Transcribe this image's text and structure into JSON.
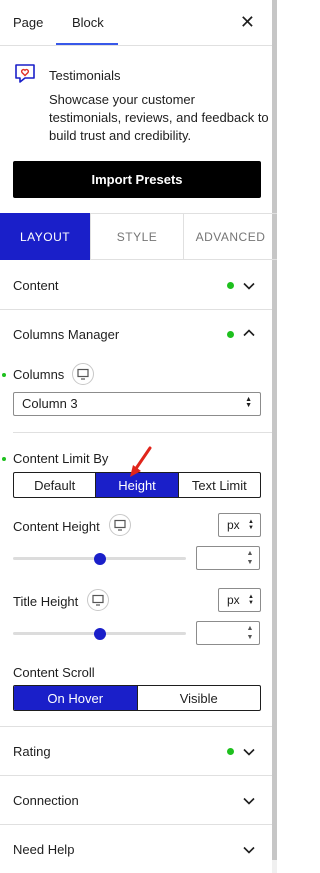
{
  "header": {
    "tabs": [
      {
        "label": "Page"
      },
      {
        "label": "Block"
      }
    ],
    "close_glyph": "✕"
  },
  "block_card": {
    "icon": "heart-chat-icon",
    "title": "Testimonials",
    "description": "Showcase your customer testimonials, reviews, and feedback to build trust and credibility."
  },
  "import_button": {
    "label": "Import Presets"
  },
  "panel_tabs": [
    {
      "label": "LAYOUT",
      "active": true
    },
    {
      "label": "STYLE",
      "active": false
    },
    {
      "label": "ADVANCED",
      "active": false
    }
  ],
  "sections": {
    "content": {
      "label": "Content"
    },
    "columns_manager": {
      "label": "Columns Manager"
    },
    "rating": {
      "label": "Rating"
    },
    "connection": {
      "label": "Connection"
    },
    "need_help": {
      "label": "Need Help"
    }
  },
  "columns": {
    "label": "Columns",
    "selected": "Column 3"
  },
  "content_limit": {
    "label": "Content Limit By",
    "options": [
      "Default",
      "Height",
      "Text Limit"
    ],
    "selected": "Height"
  },
  "content_height": {
    "label": "Content Height",
    "unit": "px",
    "slider_fraction": 0.5,
    "value": ""
  },
  "title_height": {
    "label": "Title Height",
    "unit": "px",
    "slider_fraction": 0.5,
    "value": ""
  },
  "content_scroll": {
    "label": "Content Scroll",
    "options": [
      "On Hover",
      "Visible"
    ],
    "selected": "On Hover"
  },
  "colors": {
    "accent": "#1a1fc9",
    "status_dot": "#1ec01e",
    "annotation_arrow": "#e0251b"
  }
}
